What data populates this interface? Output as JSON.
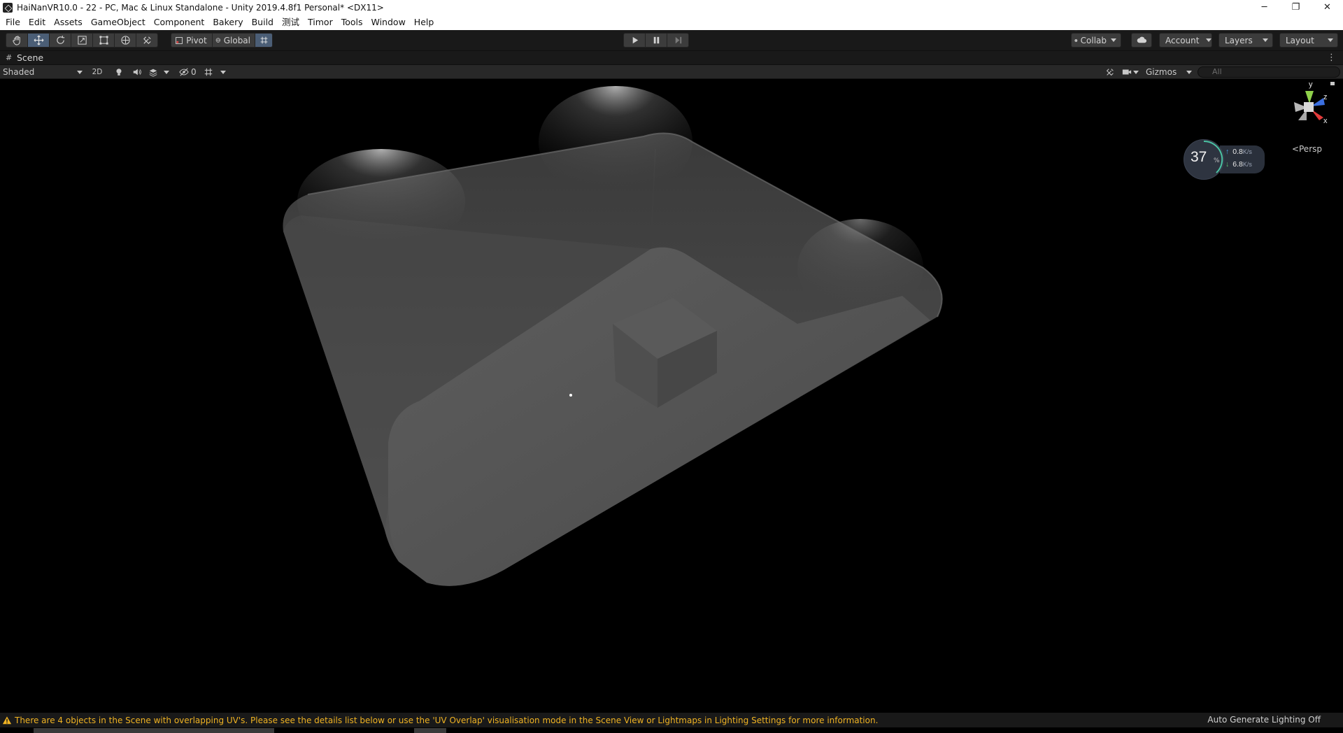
{
  "window": {
    "title": "HaiNanVR10.0 - 22 - PC, Mac & Linux Standalone - Unity 2019.4.8f1 Personal* <DX11>",
    "minimize_glyph": "─",
    "restore_glyph": "❐",
    "close_glyph": "✕"
  },
  "menu": {
    "items": [
      "File",
      "Edit",
      "Assets",
      "GameObject",
      "Component",
      "Bakery",
      "Build",
      "测试",
      "Timor",
      "Tools",
      "Window",
      "Help"
    ]
  },
  "toolbar": {
    "transform_tools": [
      "hand-tool",
      "move-tool",
      "rotate-tool",
      "scale-tool",
      "rect-tool",
      "transform-tool",
      "custom-editor-tool"
    ],
    "active_tool": "move-tool",
    "pivot_label": "Pivot",
    "global_label": "Global",
    "collab_label": "Collab",
    "account_label": "Account",
    "layers_label": "Layers",
    "layout_label": "Layout"
  },
  "scene_tab": {
    "label": "Scene"
  },
  "scene_bar": {
    "draw_mode": "Shaded",
    "mode_2d": "2D",
    "hidden_count": "0",
    "gizmos_label": "Gizmos",
    "search_placeholder": "All"
  },
  "viewport": {
    "projection_label": "Persp",
    "axis_labels": {
      "y": "y",
      "z": "z",
      "x": "x"
    }
  },
  "network_monitor": {
    "percent": "37",
    "percent_sign": "%",
    "upload": "0.8",
    "download": "6.8",
    "unit": "K/s"
  },
  "status_bar": {
    "warning": "There are 4 objects in the Scene with overlapping UV's. Please see the details list below or use the 'UV Overlap' visualisation mode in the Scene View or Lightmaps in Lighting Settings for more information.",
    "lighting": "Auto Generate Lighting Off"
  },
  "colors": {
    "warning": "#f0b323",
    "selected_tool": "#4b5e76",
    "axis_y": "#8fd14a",
    "axis_x": "#e03a3a",
    "axis_z": "#3b6fe0"
  }
}
